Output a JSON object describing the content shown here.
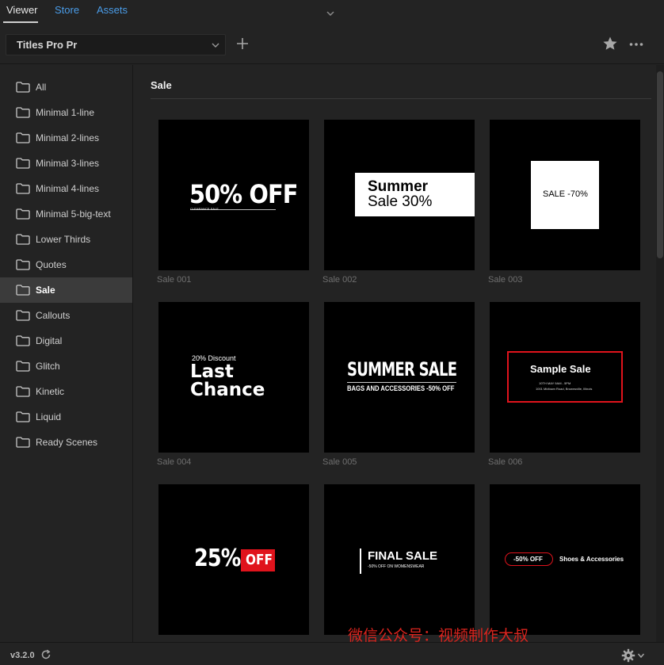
{
  "tabs": [
    {
      "label": "Viewer",
      "active": true
    },
    {
      "label": "Store",
      "active": false
    },
    {
      "label": "Assets",
      "active": false
    }
  ],
  "toolbar": {
    "pack_select": "Titles Pro Pr",
    "icons": [
      "plus-icon",
      "star-icon",
      "more-icon"
    ]
  },
  "sidebar": {
    "items": [
      {
        "label": "All"
      },
      {
        "label": "Minimal 1-line"
      },
      {
        "label": "Minimal 2-lines"
      },
      {
        "label": "Minimal 3-lines"
      },
      {
        "label": "Minimal 4-lines"
      },
      {
        "label": "Minimal 5-big-text"
      },
      {
        "label": "Lower Thirds"
      },
      {
        "label": "Quotes"
      },
      {
        "label": "Sale",
        "active": true
      },
      {
        "label": "Callouts"
      },
      {
        "label": "Digital"
      },
      {
        "label": "Glitch"
      },
      {
        "label": "Kinetic"
      },
      {
        "label": "Liquid"
      },
      {
        "label": "Ready Scenes"
      }
    ]
  },
  "main": {
    "section_title": "Sale",
    "cards": [
      {
        "label": "Sale 001",
        "art": {
          "big": "50% OFF",
          "small": "CLEARANCE SALE"
        }
      },
      {
        "label": "Sale 002",
        "art": {
          "line1": "Summer",
          "line2": "Sale 30%"
        }
      },
      {
        "label": "Sale 003",
        "art": {
          "text": "SALE -70%"
        }
      },
      {
        "label": "Sale 004",
        "art": {
          "small": "20% Discount",
          "line1": "Last",
          "line2": "Chance"
        }
      },
      {
        "label": "Sale 005",
        "art": {
          "big": "SUMMER SALE",
          "small": "BAGS AND ACCESSORIES -50% OFF"
        }
      },
      {
        "label": "Sale 006",
        "art": {
          "big": "Sample Sale",
          "small1": "10TH MAY 9AM - 5PM",
          "small2": "1001 Midtown Road, Brownsville, Illinois"
        }
      },
      {
        "label": "",
        "art": {
          "big": "25%",
          "badge": "OFF"
        }
      },
      {
        "label": "",
        "art": {
          "big": "FINAL SALE",
          "small": "-50% OFF ON WOMENSWEAR"
        }
      },
      {
        "label": "",
        "art": {
          "pill": "-50% OFF",
          "text": "Shoes & Accessories"
        }
      }
    ]
  },
  "footer": {
    "version": "v3.2.0",
    "watermark": "微信公众号：视频制作大叔"
  },
  "colors": {
    "background": "#232323",
    "accent_link": "#4a9ce8",
    "sale_red": "#e0131c",
    "active_row": "#3b3b3b"
  }
}
